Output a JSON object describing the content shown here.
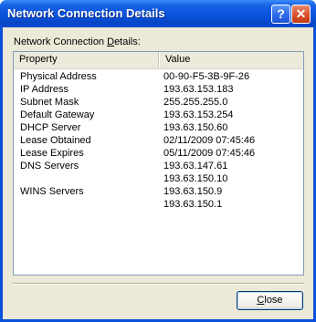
{
  "window": {
    "title": "Network Connection Details",
    "help_glyph": "?",
    "close_glyph": "✕"
  },
  "group": {
    "label_prefix": "Network Connection ",
    "label_accel": "D",
    "label_suffix": "etails:"
  },
  "table": {
    "columns": [
      "Property",
      "Value"
    ],
    "rows": [
      {
        "property": "Physical Address",
        "value": "00-90-F5-3B-9F-26"
      },
      {
        "property": "IP Address",
        "value": "193.63.153.183"
      },
      {
        "property": "Subnet Mask",
        "value": "255.255.255.0"
      },
      {
        "property": "Default Gateway",
        "value": "193.63.153.254"
      },
      {
        "property": "DHCP Server",
        "value": "193.63.150.60"
      },
      {
        "property": "Lease Obtained",
        "value": "02/11/2009 07:45:46"
      },
      {
        "property": "Lease Expires",
        "value": "05/11/2009 07:45:46"
      },
      {
        "property": "DNS Servers",
        "value": "193.63.147.61"
      },
      {
        "property": "",
        "value": "193.63.150.10"
      },
      {
        "property": "WINS Servers",
        "value": "193.63.150.9"
      },
      {
        "property": "",
        "value": "193.63.150.1"
      }
    ]
  },
  "buttons": {
    "close_accel": "C",
    "close_rest": "lose"
  },
  "icons": {
    "help": "help-icon",
    "close": "close-icon"
  },
  "colors": {
    "titlebar": "#0a52dc",
    "client_bg": "#ece9d8",
    "list_border": "#7f9db9",
    "close_button": "#c23a16"
  }
}
